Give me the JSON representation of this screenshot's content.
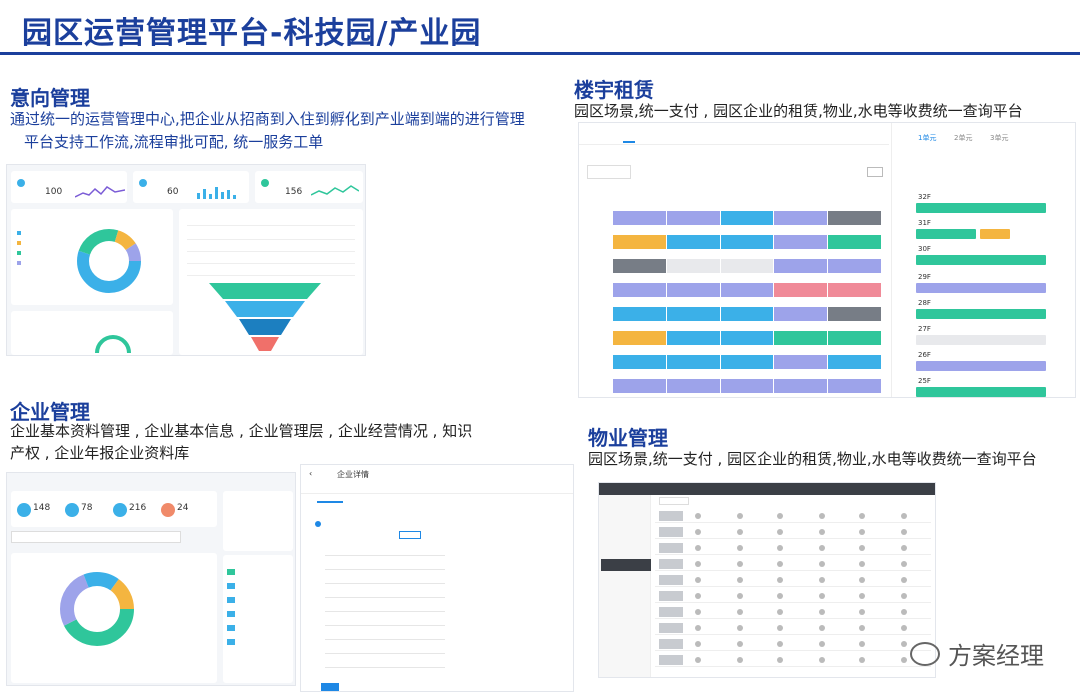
{
  "header": {
    "title": "园区运营管理平台-科技园/产业园"
  },
  "sections": {
    "intent": {
      "title": "意向管理",
      "desc_line1": "通过统一的运营管理中心,把企业从招商到入住到孵化到产业端到端的进行管理",
      "desc_line2": "平台支持工作流,流程审批可配, 统一服务工单",
      "stats": [
        "100",
        "60",
        "156"
      ]
    },
    "leasing": {
      "title": "楼宇租赁",
      "desc": "园区场景,统一支付 , 园区企业的租赁,物业,水电等收费统一查询平台",
      "tabs": [
        "1单元",
        "2单元",
        "3单元"
      ],
      "floors": [
        "32F",
        "31F",
        "30F",
        "29F",
        "28F",
        "27F",
        "26F",
        "25F"
      ]
    },
    "enterprise": {
      "title": "企业管理",
      "desc_line1": "企业基本资料管理 ,  企业基本信息 , 企业管理层 , 企业经营情况 , 知识",
      "desc_line2": "产权 , 企业年报企业资料库",
      "stats": [
        "148",
        "78",
        "216",
        "24"
      ],
      "detail_title": "企业详情"
    },
    "property": {
      "title": "物业管理",
      "desc": "园区场景,统一支付 , 园区企业的租赁,物业,水电等收费统一查询平台"
    }
  },
  "watermark": {
    "text": "方案经理"
  },
  "colors": {
    "brand": "#1b3f9c",
    "blue": "#3bb0e8",
    "lavender": "#9da3ea",
    "teal": "#2fc69b",
    "orange": "#f4b540",
    "pink": "#f08a98",
    "gray": "#777d86"
  }
}
